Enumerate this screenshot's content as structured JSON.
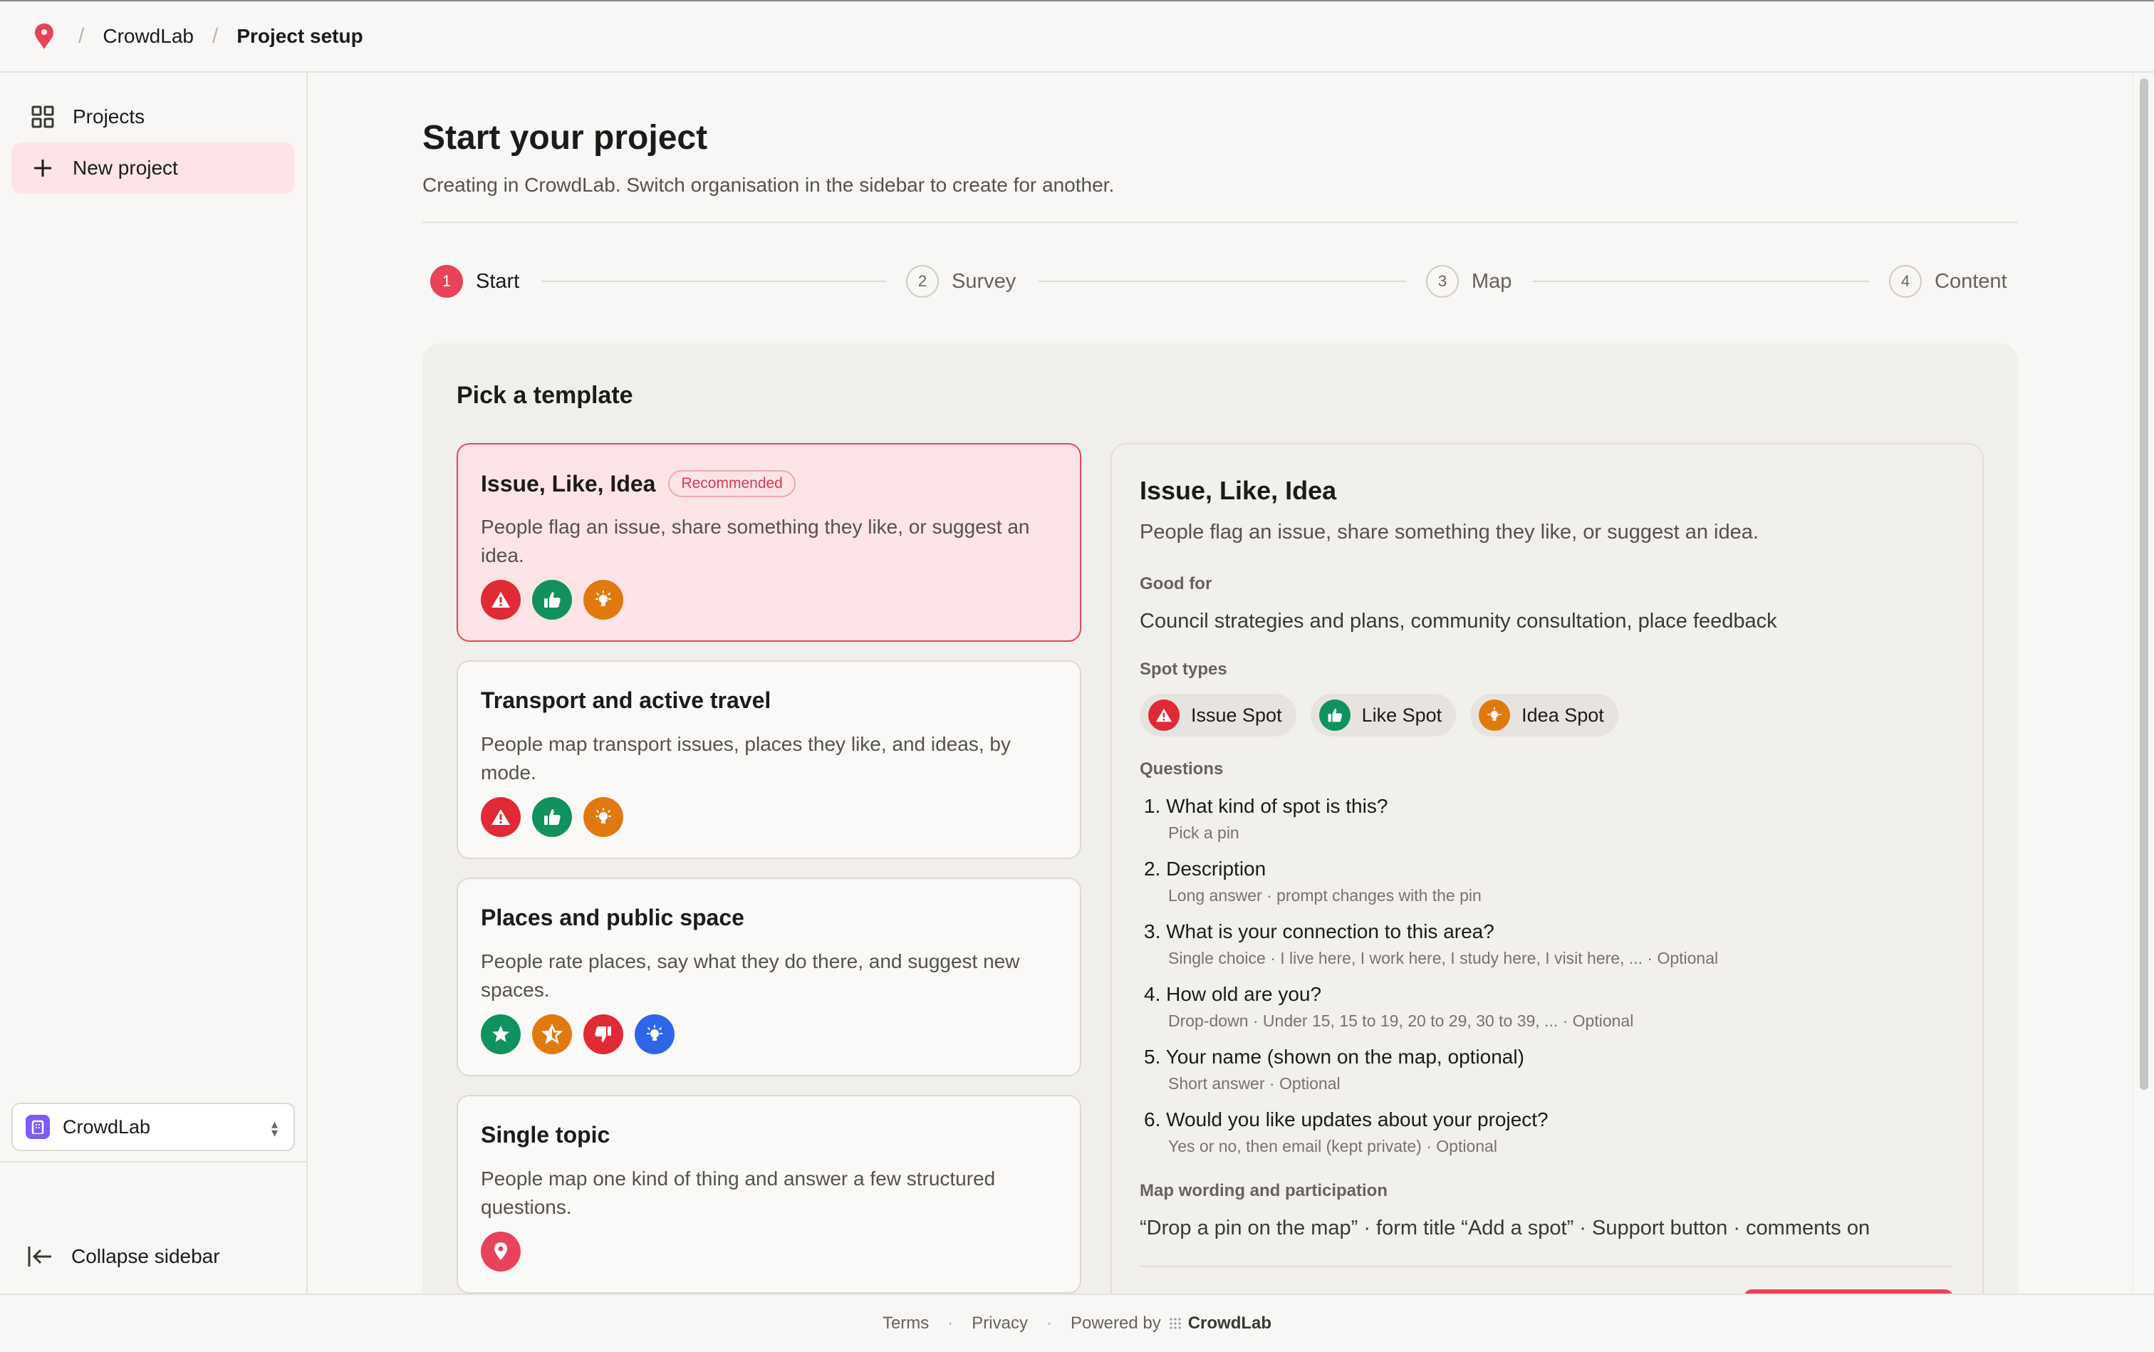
{
  "topbar": {
    "org": "CrowdLab",
    "page": "Project setup"
  },
  "sidebar": {
    "items": [
      {
        "label": "Projects",
        "icon": "grid-icon"
      },
      {
        "label": "New project",
        "icon": "plus-icon"
      }
    ],
    "org_select": "CrowdLab",
    "collapse_label": "Collapse sidebar"
  },
  "main": {
    "title": "Start your project",
    "subtitle": "Creating in CrowdLab. Switch organisation in the sidebar to create for another.",
    "steps": [
      {
        "num": "1",
        "label": "Start"
      },
      {
        "num": "2",
        "label": "Survey"
      },
      {
        "num": "3",
        "label": "Map"
      },
      {
        "num": "4",
        "label": "Content"
      }
    ],
    "pick_title": "Pick a template",
    "templates": [
      {
        "title": "Issue, Like, Idea",
        "badge": "Recommended",
        "desc": "People flag an issue, share something they like, or suggest an idea."
      },
      {
        "title": "Transport and active travel",
        "desc": "People map transport issues, places they like, and ideas, by mode."
      },
      {
        "title": "Places and public space",
        "desc": "People rate places, say what they do there, and suggest new spaces."
      },
      {
        "title": "Single topic",
        "desc": "People map one kind of thing and answer a few structured questions."
      }
    ]
  },
  "detail": {
    "title": "Issue, Like, Idea",
    "desc": "People flag an issue, share something they like, or suggest an idea.",
    "good_for_label": "Good for",
    "good_for": "Council strategies and plans, community consultation, place feedback",
    "spot_types_label": "Spot types",
    "spot_types": [
      "Issue Spot",
      "Like Spot",
      "Idea Spot"
    ],
    "questions_label": "Questions",
    "questions": [
      {
        "title": "1. What kind of spot is this?",
        "sub": "Pick a pin"
      },
      {
        "title": "2. Description",
        "sub": "Long answer · prompt changes with the pin"
      },
      {
        "title": "3. What is your connection to this area?",
        "sub": "Single choice · I live here, I work here, I study here, I visit here, ... · Optional"
      },
      {
        "title": "4. How old are you?",
        "sub": "Drop-down · Under 15, 15 to 19, 20 to 29, 30 to 39, ... · Optional"
      },
      {
        "title": "5. Your name (shown on the map, optional)",
        "sub": "Short answer · Optional"
      },
      {
        "title": "6. Would you like updates about your project?",
        "sub": "Yes or no, then email (kept private) · Optional"
      }
    ],
    "map_wording_label": "Map wording and participation",
    "map_wording": "“Drop a pin on the map” · form title “Add a spot” · Support button · comments on"
  },
  "footer": {
    "terms": "Terms",
    "privacy": "Privacy",
    "powered_by": "Powered by",
    "brand": "CrowdLab"
  },
  "colors": {
    "accent": "#e8435a",
    "issue": "#e02a36",
    "like": "#11915d",
    "idea": "#e07a10",
    "blue": "#2f66e8",
    "org_badge": "#7c5cf2"
  }
}
